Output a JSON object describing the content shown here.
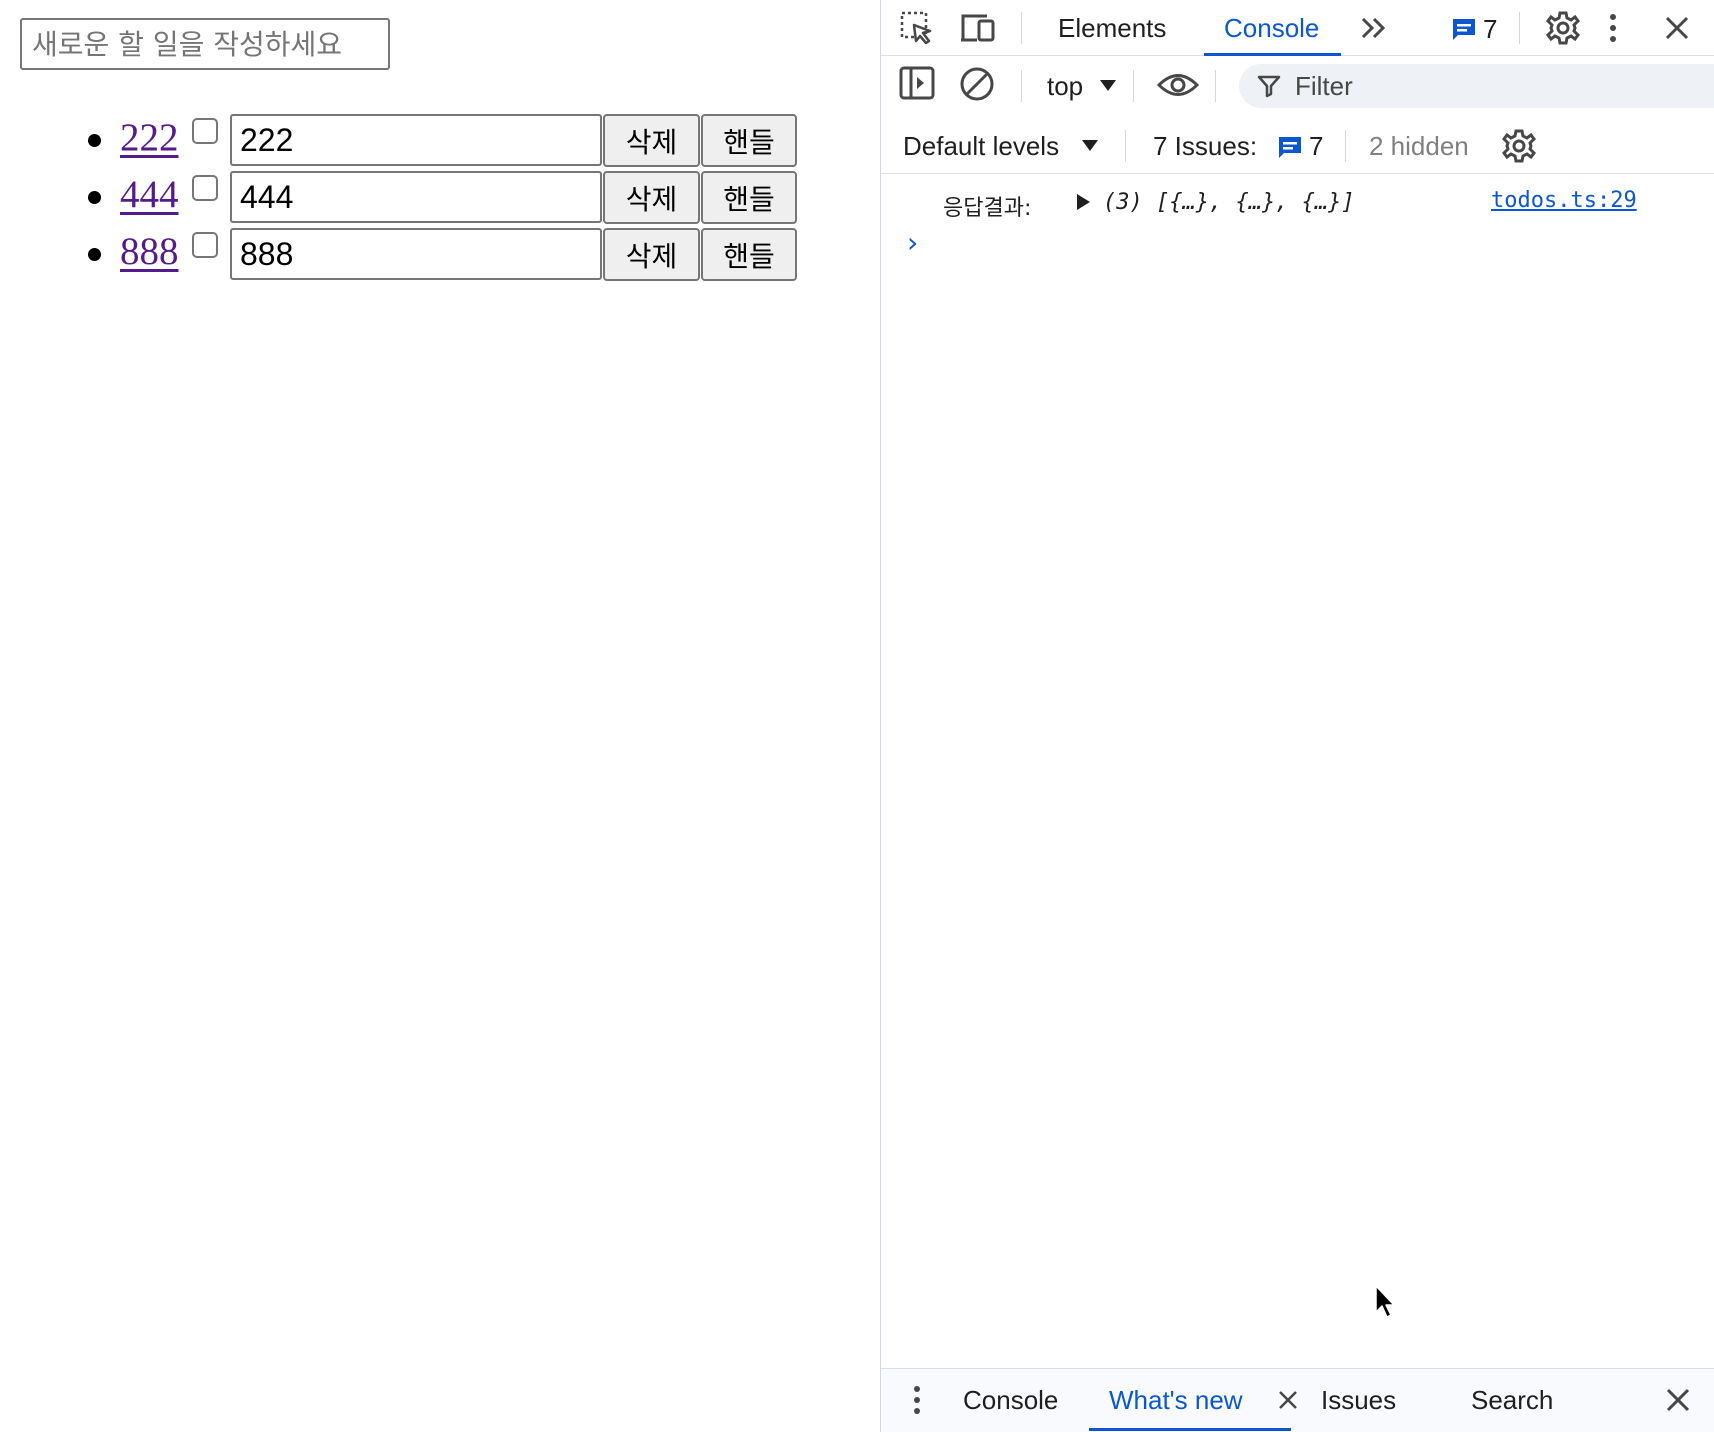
{
  "page": {
    "new_todo_placeholder": "새로운 할 일을 작성하세요",
    "todos": [
      {
        "link": "222",
        "value": "222",
        "delete_label": "삭제",
        "handle_label": "핸들"
      },
      {
        "link": "444",
        "value": "444",
        "delete_label": "삭제",
        "handle_label": "핸들"
      },
      {
        "link": "888",
        "value": "888",
        "delete_label": "삭제",
        "handle_label": "핸들"
      }
    ]
  },
  "devtools": {
    "tabs": {
      "elements": "Elements",
      "console": "Console"
    },
    "issues_badge_count": "7",
    "toolbar": {
      "context": "top",
      "filter_placeholder": "Filter"
    },
    "levels": {
      "default_levels": "Default levels",
      "issues_label": "7 Issues:",
      "issues_count": "7",
      "hidden": "2 hidden"
    },
    "console_log": {
      "label": "응답결과:",
      "value": "(3) [{…}, {…}, {…}]",
      "source": "todos.ts:29"
    },
    "drawer": {
      "console": "Console",
      "whats_new": "What's new",
      "issues": "Issues",
      "search": "Search"
    },
    "colors": {
      "accent": "#0b57d0",
      "text": "#1f1f1f",
      "link_visited": "#551a8b"
    }
  }
}
